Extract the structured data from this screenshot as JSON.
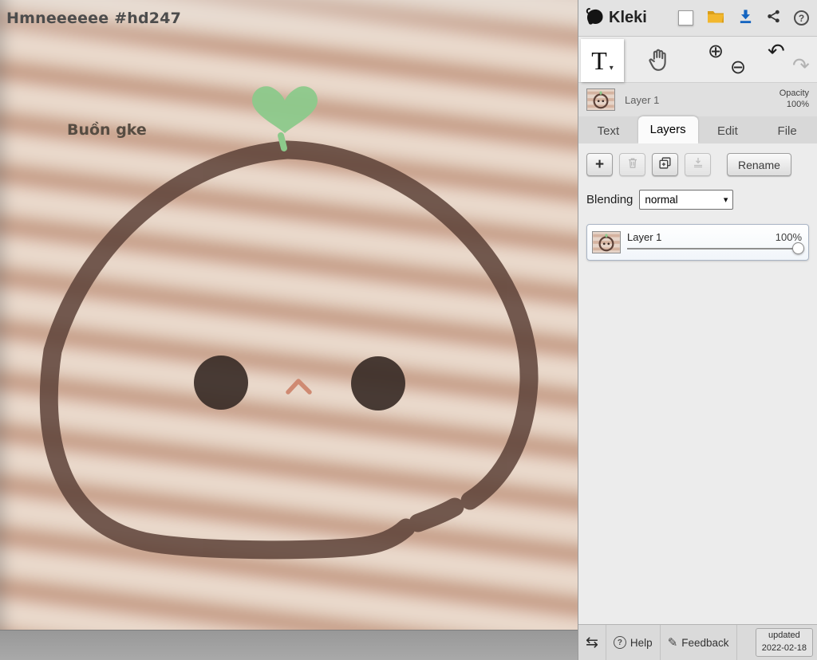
{
  "app": {
    "name": "Kleki"
  },
  "canvas": {
    "title": "Hmneeeeee #hd247",
    "caption": "Buồn gke"
  },
  "icons": {
    "text_tool": "T",
    "tool_caret": "▾",
    "zoom_in": "⊕",
    "zoom_out": "⊖",
    "undo": "↶",
    "redo": "↷",
    "add": "+",
    "select_caret": "▾",
    "swap": "⇆",
    "help_glyph": "?",
    "pen": "✎"
  },
  "layer_bar": {
    "name": "Layer 1",
    "opacity_label": "Opacity",
    "opacity_value": "100%"
  },
  "tabs": [
    {
      "label": "Text"
    },
    {
      "label": "Layers"
    },
    {
      "label": "Edit"
    },
    {
      "label": "File"
    }
  ],
  "panel": {
    "rename": "Rename",
    "blending_label": "Blending",
    "blending_value": "normal",
    "layer": {
      "name": "Layer 1",
      "opacity": "100%"
    }
  },
  "footer": {
    "help": "Help",
    "feedback": "Feedback",
    "updated_label": "updated",
    "updated_date": "2022-02-18"
  },
  "colors": {
    "outline_brown": "#5d4238",
    "eye_brown": "#3a2c27",
    "nose_salmon": "#cf8a72",
    "sprout_green": "#8cc98b",
    "download_blue": "#1565c0",
    "folder_yellow": "#f2b72e"
  }
}
